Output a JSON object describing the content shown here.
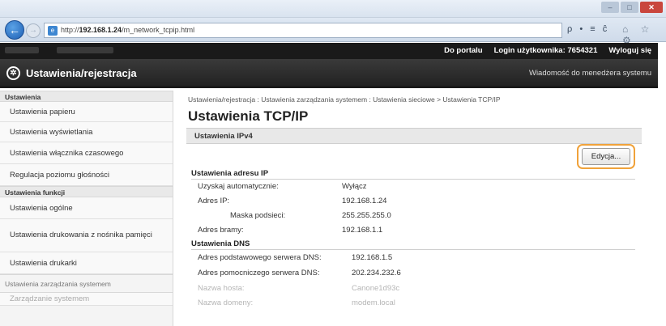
{
  "browser": {
    "url_host": "192.168.1.24",
    "url_path": "/m_network_tcpip.html",
    "url_prefix": "http://",
    "back_glyph": "←",
    "forward_glyph": "→",
    "right_controls": "ρ • ≡ ĉ",
    "right_icons": "⌂ ☆ ⚙",
    "window_min": "–",
    "window_max": "□",
    "window_close": "✕"
  },
  "topnav": {
    "portal_link": "Do portalu",
    "login_label": "Login użytkownika:",
    "user_id": "7654321",
    "logout_link": "Wyloguj się"
  },
  "app": {
    "title": "Ustawienia/rejestracja",
    "admin_message": "Wiadomość do menedżera systemu"
  },
  "sidebar": {
    "section_settings": "Ustawienia",
    "items_settings": [
      "Ustawienia papieru",
      "Ustawienia wyświetlania",
      "Ustawienia włącznika czasowego",
      "Regulacja poziomu głośności"
    ],
    "section_functions": "Ustawienia funkcji",
    "items_functions": [
      "Ustawienia ogólne",
      "Ustawienia drukowania z nośnika pamięci",
      "Ustawienia drukarki"
    ],
    "section_system": "Ustawienia zarządzania systemem",
    "item_faded": "Zarządzanie systemem"
  },
  "main": {
    "breadcrumb": "Ustawienia/rejestracja : Ustawienia zarządzania systemem : Ustawienia sieciowe > Ustawienia TCP/IP",
    "page_title": "Ustawienia TCP/IP",
    "section_title": "Ustawienia IPv4",
    "edit_button": "Edycja...",
    "ip_heading": "Ustawienia adresu IP",
    "ip_rows": [
      {
        "label": "Uzyskaj automatycznie:",
        "value": "Wyłącz"
      },
      {
        "label": "Adres IP:",
        "value": "192.168.1.24"
      },
      {
        "label": "Maska podsieci:",
        "value": "255.255.255.0"
      },
      {
        "label": "Adres bramy:",
        "value": "192.168.1.1"
      }
    ],
    "dns_heading": "Ustawienia DNS",
    "dns_rows": [
      {
        "label": "Adres podstawowego serwera DNS:",
        "value": "192.168.1.5"
      },
      {
        "label": "Adres pomocniczego serwera DNS:",
        "value": "202.234.232.6"
      },
      {
        "label": "Nazwa hosta:",
        "value": "Canone1d93c"
      },
      {
        "label": "Nazwa domeny:",
        "value": "modem.local"
      }
    ]
  },
  "colors": {
    "highlight": "#f0a23a",
    "header_bg": "#222222"
  }
}
